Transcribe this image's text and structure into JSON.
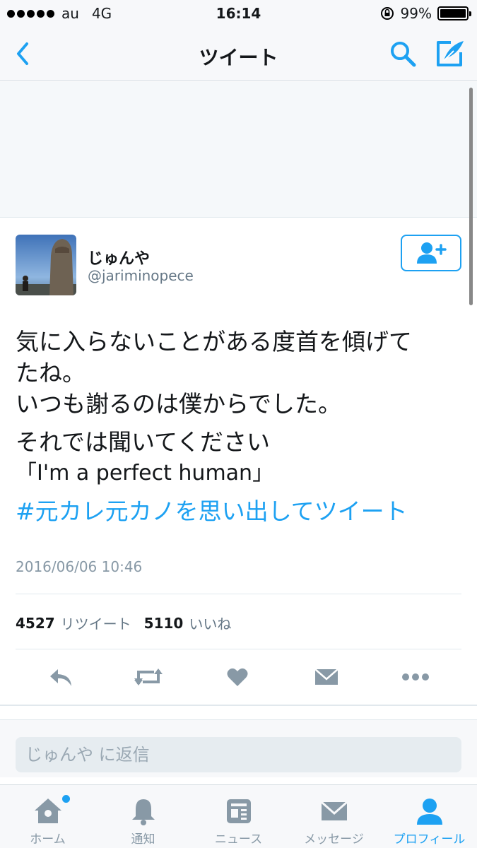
{
  "status_bar": {
    "carrier": "au",
    "network": "4G",
    "time": "16:14",
    "battery": "99%",
    "battery_level": 0.99
  },
  "nav": {
    "title": "ツイート"
  },
  "tweet": {
    "user_name": "じゅんや",
    "user_handle": "@jariminopece",
    "text_lines": [
      "気に入らないことがある度首を傾げて",
      "たね。",
      "いつも謝るのは僕からでした。",
      "それでは聞いてください",
      "「I'm a perfect human」"
    ],
    "hashtag": "#元カレ元カノを思い出してツイート",
    "timestamp": "2016/06/06 10:46",
    "retweet_count": "4527",
    "retweet_label": "リツイート",
    "like_count": "5110",
    "like_label": "いいね"
  },
  "reply": {
    "placeholder": "じゅんや に返信"
  },
  "tabs": [
    {
      "label": "ホーム",
      "icon": "home-icon"
    },
    {
      "label": "通知",
      "icon": "bell-icon"
    },
    {
      "label": "ニュース",
      "icon": "news-icon"
    },
    {
      "label": "メッセージ",
      "icon": "envelope-icon"
    },
    {
      "label": "プロフィール",
      "icon": "person-icon"
    }
  ],
  "colors": {
    "accent": "#1da1f2",
    "icon_gray": "#8899a6",
    "text": "#14171a"
  }
}
